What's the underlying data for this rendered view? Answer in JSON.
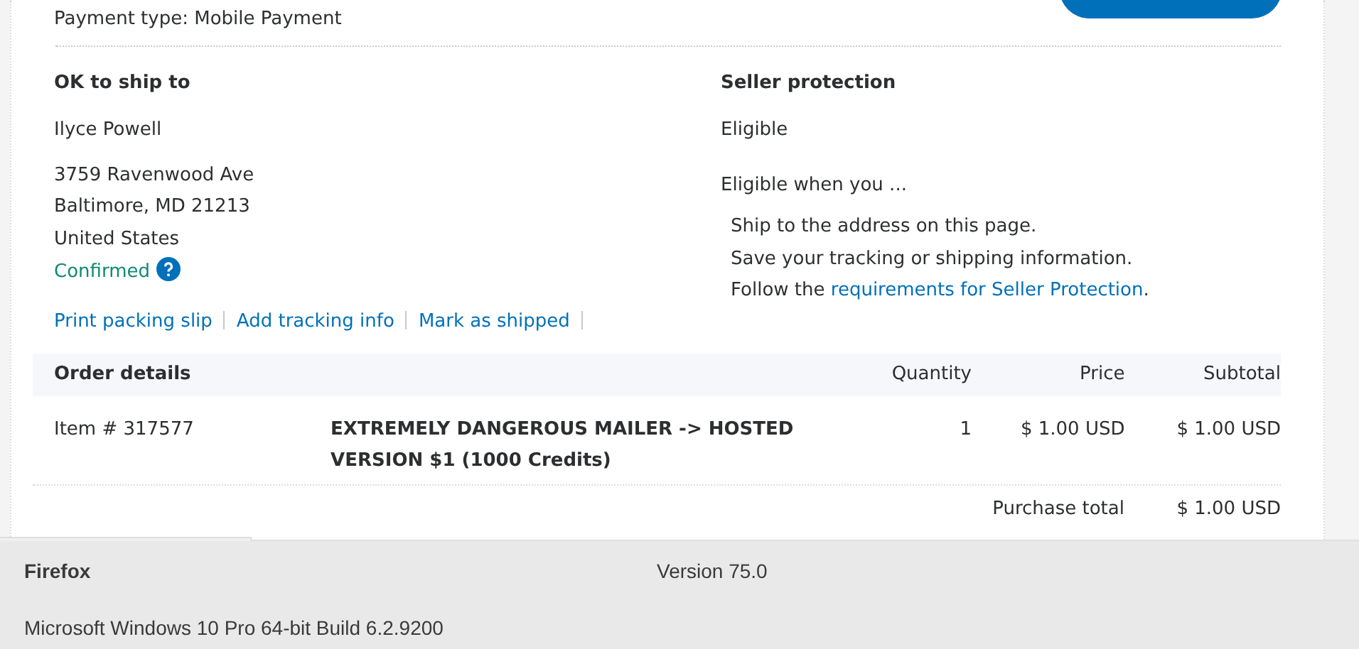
{
  "payment_type": "Payment type: Mobile Payment",
  "ship_to": {
    "heading": "OK to ship to",
    "name": "Ilyce Powell",
    "address_lines": [
      "3759 Ravenwood Ave",
      "Baltimore, MD 21213",
      "United States"
    ],
    "status": "Confirmed",
    "links": [
      "Print packing slip",
      "Add tracking info",
      "Mark as shipped"
    ]
  },
  "seller_protection": {
    "heading": "Seller protection",
    "status": "Eligible",
    "intro": "Eligible when you ...",
    "conditions": [
      {
        "text": "Ship to the address on this page."
      },
      {
        "text": "Save your tracking or shipping information."
      },
      {
        "text": "Follow the ",
        "link": "requirements for Seller Protection",
        "suffix": "."
      }
    ]
  },
  "order": {
    "columns": [
      "Order details",
      "Quantity",
      "Price",
      "Subtotal"
    ],
    "items": [
      {
        "item": "Item # 317577",
        "description": "EXTREMELY DANGEROUS MAILER -> HOSTED VERSION $1 (1000 Credits)",
        "quantity": "1",
        "price": "$ 1.00 USD",
        "subtotal": "$ 1.00 USD"
      }
    ],
    "total_label": "Purchase total",
    "total": "$ 1.00 USD"
  },
  "about": {
    "browser": "Firefox",
    "version": "Version 75.0",
    "os": "Microsoft Windows 10 Pro 64-bit Build 6.2.9200"
  }
}
